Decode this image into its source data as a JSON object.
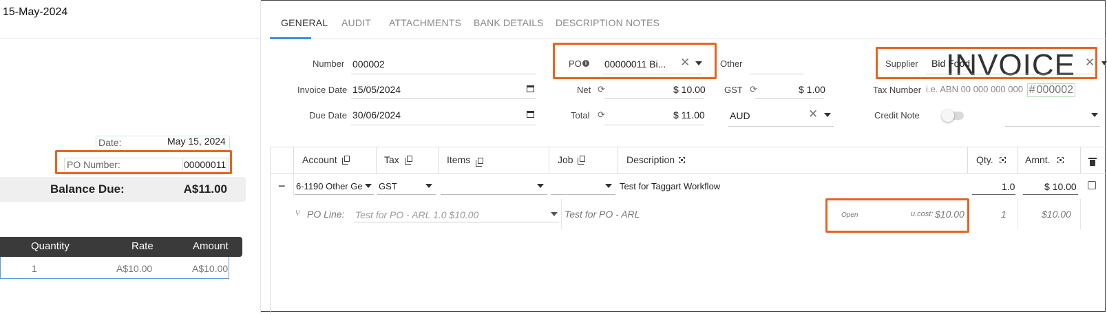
{
  "preview": {
    "date": "15-May-2024",
    "title": "INVOICE",
    "hash": "#",
    "number": "000002",
    "date_label": "Date:",
    "date_value": "May 15, 2024",
    "po_label": "PO Number:",
    "po_value": "00000011",
    "balance_label": "Balance Due:",
    "balance_value": "A$11.00",
    "columns": [
      "Quantity",
      "Rate",
      "Amount"
    ],
    "row": {
      "quantity": "1",
      "rate": "A$10.00",
      "amount": "A$10.00"
    }
  },
  "tabs": [
    "GENERAL",
    "AUDIT",
    "ATTACHMENTS",
    "BANK DETAILS",
    "DESCRIPTION NOTES"
  ],
  "active_tab": "GENERAL",
  "form": {
    "number_label": "Number",
    "number_value": "000002",
    "invoice_date_label": "Invoice Date",
    "invoice_date_value": "15/05/2024",
    "due_date_label": "Due Date",
    "due_date_value": "30/06/2024",
    "po_label": "PO",
    "po_value": "00000011 Bi...",
    "net_label": "Net",
    "net_value": "$ 10.00",
    "total_label": "Total",
    "total_value": "$ 11.00",
    "other_label": "Other",
    "gst_label": "GST",
    "gst_value": "$ 1.00",
    "currency_value": "AUD",
    "supplier_label": "Supplier",
    "supplier_value": "Bid Food",
    "tax_number_label": "Tax Number",
    "tax_number_placeholder": "i.e. ABN 00 000 000 000",
    "credit_note_label": "Credit Note"
  },
  "grid": {
    "headers": {
      "account": "Account",
      "tax": "Tax",
      "items": "Items",
      "job": "Job",
      "description": "Description",
      "qty": "Qty.",
      "amount": "Amnt."
    },
    "row": {
      "collapse": "−",
      "account": "6-1190 Other Ge",
      "tax": "GST",
      "description": "Test for Taggart Workflow",
      "qty": "1.0",
      "amount": "$ 10.00"
    },
    "po_line": {
      "label": "PO Line:",
      "value": "Test for PO - ARL 1.0 $10.00",
      "description": "Test for PO - ARL",
      "status": "Open",
      "ucost_label": "u.cost:",
      "ucost_value": "$10.00",
      "qty": "1",
      "amount": "$10.00"
    }
  },
  "colors": {
    "accent": "#3b8fd5",
    "highlight": "#e8641e"
  }
}
